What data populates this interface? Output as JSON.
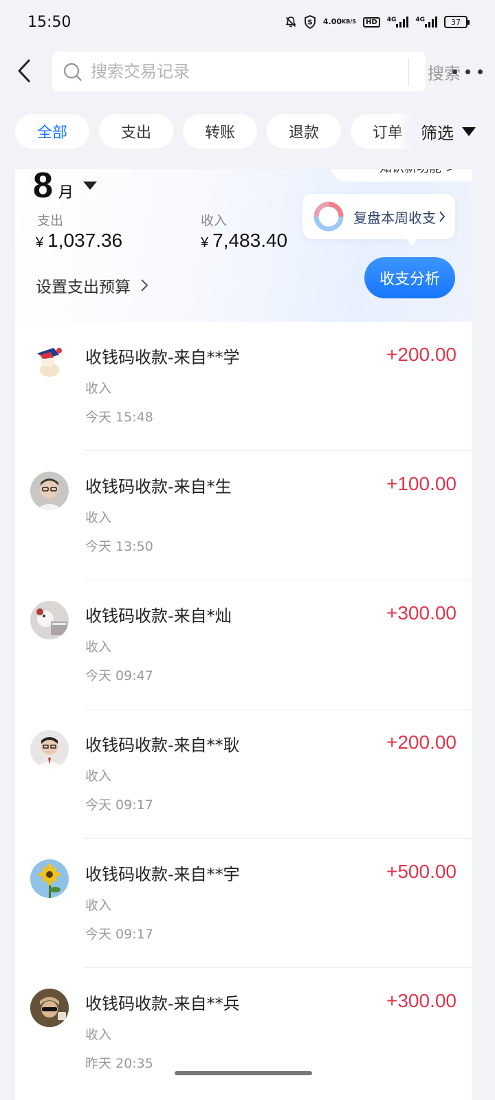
{
  "status_bar": {
    "time": "15:50",
    "speed_top": "4.00",
    "speed_bottom": "KB/S",
    "hd": "HD",
    "net1": "4G",
    "net2": "4G",
    "battery": "37"
  },
  "header": {
    "search_placeholder": "搜索交易记录",
    "search_button": "搜索"
  },
  "filters": {
    "chips": [
      "全部",
      "支出",
      "转账",
      "退款",
      "订单"
    ],
    "active_index": 0,
    "filter_label": "筛选"
  },
  "summary": {
    "month_number": "8",
    "month_unit": "月",
    "feature_hint": "知识新功能 >",
    "expense_label": "支出",
    "expense_value": "1,037.36",
    "income_label": "收入",
    "income_value": "7,483.40",
    "currency": "¥",
    "budget_label": "设置支出预算",
    "weekly_review": "复盘本周收支",
    "analysis_button": "收支分析"
  },
  "transactions": [
    {
      "title": "收钱码收款-来自**学",
      "type": "收入",
      "time": "今天 15:48",
      "amount": "+200.00",
      "avatar": "cartoon-avatar"
    },
    {
      "title": "收钱码收款-来自*生",
      "type": "收入",
      "time": "今天 13:50",
      "amount": "+100.00",
      "avatar": "photo-avatar"
    },
    {
      "title": "收钱码收款-来自*灿",
      "type": "收入",
      "time": "今天 09:47",
      "amount": "+300.00",
      "avatar": "photo-avatar"
    },
    {
      "title": "收钱码收款-来自**耿",
      "type": "收入",
      "time": "今天 09:17",
      "amount": "+200.00",
      "avatar": "photo-avatar"
    },
    {
      "title": "收钱码收款-来自**宇",
      "type": "收入",
      "time": "今天 09:17",
      "amount": "+500.00",
      "avatar": "sunflower-avatar"
    },
    {
      "title": "收钱码收款-来自**兵",
      "type": "收入",
      "time": "昨天 20:35",
      "amount": "+300.00",
      "avatar": "photo-avatar"
    }
  ],
  "colors": {
    "accent": "#1677ff",
    "income": "#e0364c",
    "background": "#f2f3f6"
  }
}
